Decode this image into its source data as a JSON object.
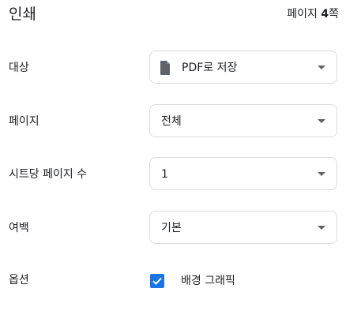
{
  "header": {
    "title": "인쇄",
    "page_count_prefix": "페이지 ",
    "page_count_number": "4",
    "page_count_suffix": "쪽"
  },
  "settings": {
    "destination": {
      "label": "대상",
      "value": "PDF로 저장",
      "icon": "file-icon"
    },
    "pages": {
      "label": "페이지",
      "value": "전체"
    },
    "pages_per_sheet": {
      "label": "시트당 페이지 수",
      "value": "1"
    },
    "margins": {
      "label": "여백",
      "value": "기본"
    },
    "options": {
      "label": "옵션",
      "background_graphics_label": "배경 그래픽",
      "background_graphics_checked": true
    }
  },
  "colors": {
    "accent": "#1a73e8",
    "border": "#dadce0",
    "text": "#202124",
    "icon": "#5f6368"
  }
}
